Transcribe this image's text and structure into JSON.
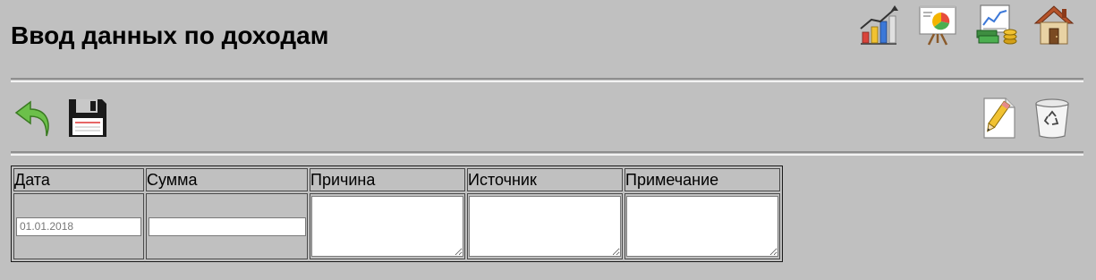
{
  "page": {
    "title": "Ввод данных по доходам"
  },
  "nav_icons": [
    {
      "icon": "bar-chart-growth-icon"
    },
    {
      "icon": "presentation-pie-chart-icon"
    },
    {
      "icon": "chart-money-icon"
    },
    {
      "icon": "home-icon"
    }
  ],
  "toolbar": {
    "left": [
      {
        "icon": "back-arrow-icon"
      },
      {
        "icon": "save-floppy-icon"
      }
    ],
    "right": [
      {
        "icon": "new-document-pencil-icon"
      },
      {
        "icon": "recycle-bin-icon"
      }
    ]
  },
  "table": {
    "columns": [
      "Дата",
      "Сумма",
      "Причина",
      "Источник",
      "Примечание"
    ],
    "row": {
      "date_placeholder": "01.01.2018",
      "amount_value": "",
      "reason_value": "",
      "source_value": "",
      "note_value": ""
    }
  },
  "colors": {
    "background": "#c0c0c0"
  }
}
